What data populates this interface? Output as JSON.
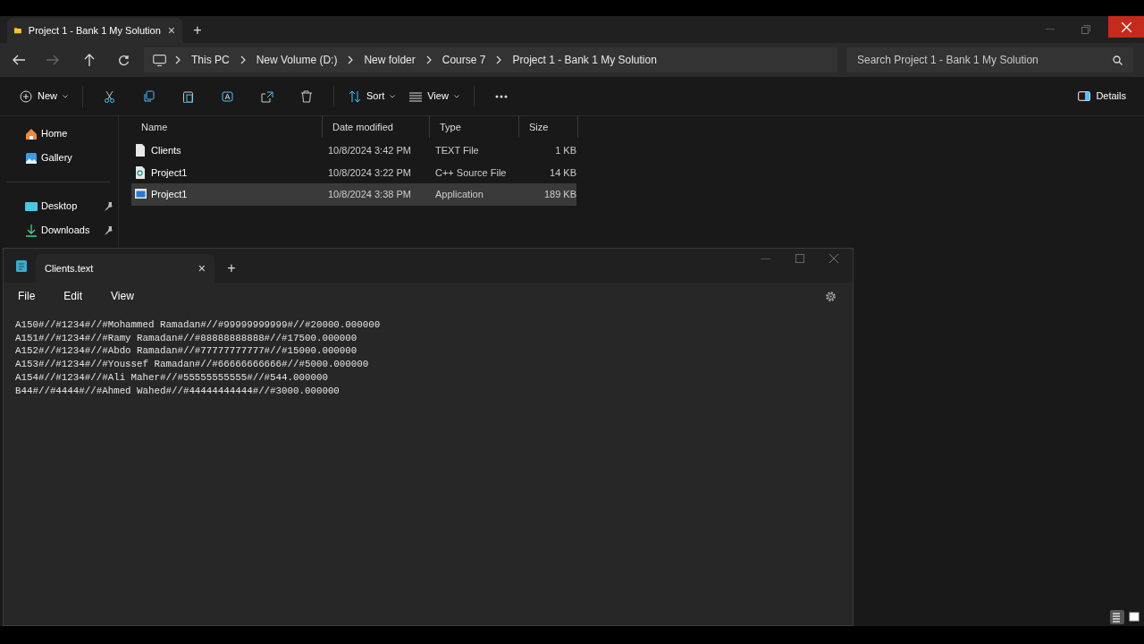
{
  "explorer": {
    "tab": {
      "title": "Project 1 - Bank 1 My Solution",
      "close": "×",
      "new": "+"
    },
    "breadcrumbs": [
      "This PC",
      "New Volume (D:)",
      "New folder",
      "Course 7",
      "Project 1 - Bank 1 My Solution"
    ],
    "search": {
      "placeholder": "Search Project 1 - Bank 1 My Solution"
    },
    "toolbar": [
      {
        "kind": "new",
        "label": "New"
      },
      {
        "kind": "cut"
      },
      {
        "kind": "copy"
      },
      {
        "kind": "paste"
      },
      {
        "kind": "rename"
      },
      {
        "kind": "share"
      },
      {
        "kind": "delete"
      },
      {
        "kind": "sort",
        "label": "Sort"
      },
      {
        "kind": "view",
        "label": "View"
      },
      {
        "kind": "more"
      }
    ],
    "details": "Details",
    "sidebar": {
      "items": [
        {
          "label": "Home",
          "kind": "home",
          "pinned": false
        },
        {
          "label": "Gallery",
          "kind": "gallery",
          "pinned": false
        },
        {
          "label": "Desktop",
          "kind": "desktop",
          "pinned": true
        },
        {
          "label": "Downloads",
          "kind": "downloads",
          "pinned": true
        }
      ]
    },
    "table": {
      "columns": [
        "Name",
        "Date modified",
        "Type",
        "Size"
      ],
      "rows": [
        {
          "kind": "text",
          "name": "Clients",
          "date": "10/8/2024 3:42 PM",
          "type": "TEXT File",
          "size": "1 KB",
          "selected": false
        },
        {
          "kind": "cpp",
          "name": "Project1",
          "date": "10/8/2024 3:22 PM",
          "type": "C++ Source File",
          "size": "14 KB",
          "selected": false
        },
        {
          "kind": "app",
          "name": "Project1",
          "date": "10/8/2024 3:38 PM",
          "type": "Application",
          "size": "189 KB",
          "selected": true
        }
      ]
    },
    "view_buttons": [
      {
        "kind": "details",
        "selected": true
      },
      {
        "kind": "tiles",
        "selected": false
      }
    ]
  },
  "notepad": {
    "tab": {
      "title": "Clients.text",
      "close": "×",
      "new": "+"
    },
    "menu": [
      "File",
      "Edit",
      "View"
    ],
    "lines": [
      "A150#//#1234#//#Mohammed Ramadan#//#99999999999#//#20000.000000",
      "A151#//#1234#//#Ramy Ramadan#//#88888888888#//#17500.000000",
      "A152#//#1234#//#Abdo Ramadan#//#77777777777#//#15000.000000",
      "A153#//#1234#//#Youssef Ramadan#//#66666666666#//#5000.000000",
      "A154#//#1234#//#Ali Maher#//#55555555555#//#544.000000",
      "B44#//#4444#//#Ahmed Wahed#//#44444444444#//#3000.000000"
    ]
  }
}
